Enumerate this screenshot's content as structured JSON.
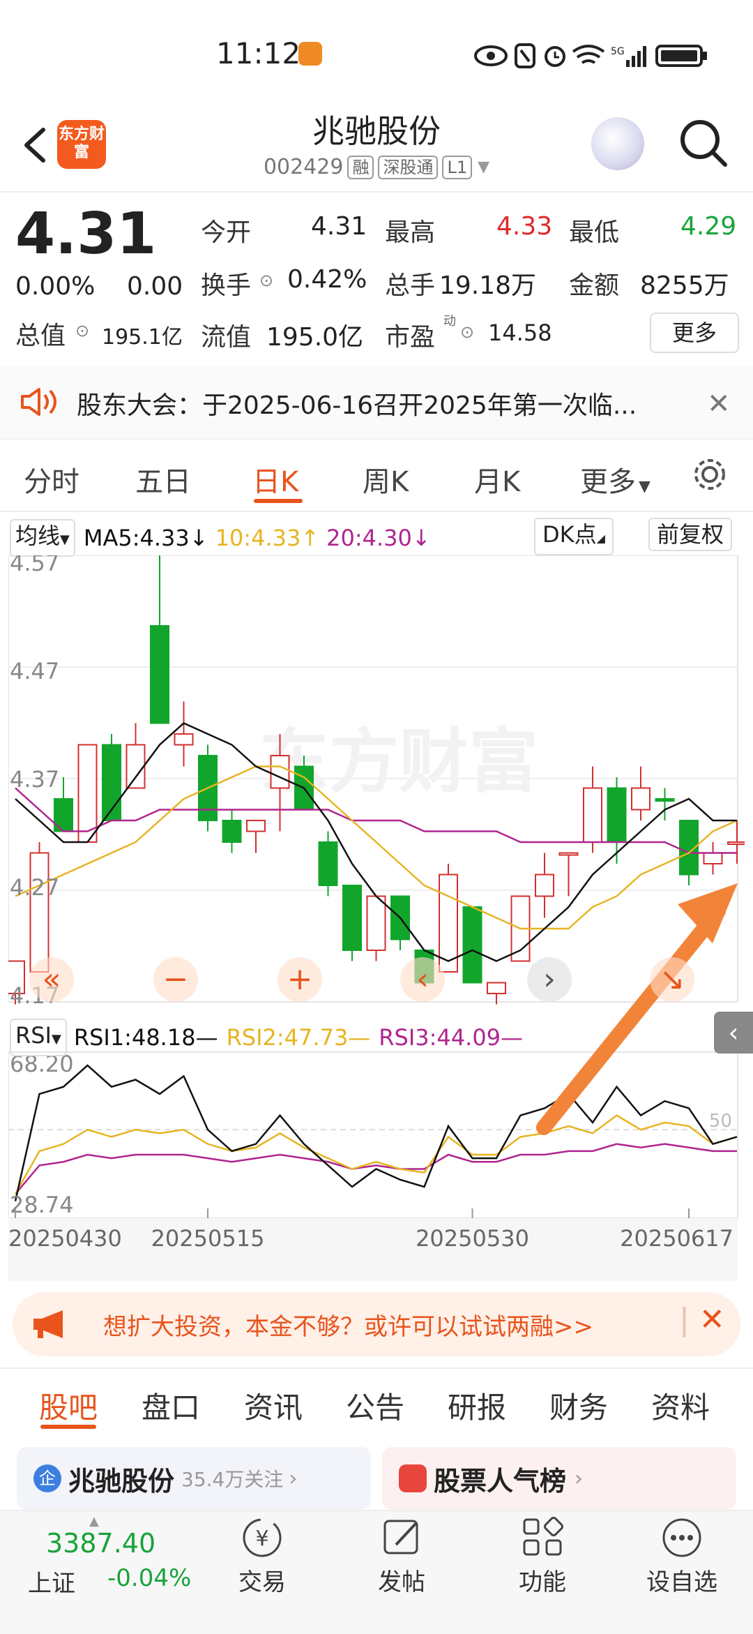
{
  "status_bar": {
    "time": "11:12",
    "network": "5G",
    "icons": [
      "eye-icon",
      "nfc-icon",
      "alarm-icon",
      "wifi-icon",
      "signal-icon",
      "battery-icon"
    ]
  },
  "header": {
    "logo_text": "东方财富",
    "name": "兆驰股份",
    "code": "002429",
    "tags": [
      "融",
      "深股通",
      "L1"
    ]
  },
  "quote": {
    "price": "4.31",
    "change_pct": "0.00%",
    "change": "0.00",
    "fields": {
      "open_label": "今开",
      "open": "4.31",
      "high_label": "最高",
      "high": "4.33",
      "low_label": "最低",
      "low": "4.29",
      "turnover_label": "换手",
      "turnover": "0.42%",
      "volume_label": "总手",
      "volume": "19.18万",
      "amount_label": "金额",
      "amount": "8255万",
      "mktcap_label": "总值",
      "mktcap": "195.1亿",
      "float_label": "流值",
      "float": "195.0亿",
      "pe_label": "市盈",
      "pe_sup": "动",
      "pe": "14.58"
    },
    "more_label": "更多"
  },
  "notice": {
    "text": "股东大会：于2025-06-16召开2025年第一次临..."
  },
  "period_tabs": [
    "分时",
    "五日",
    "日K",
    "周K",
    "月K",
    "更多"
  ],
  "active_period": "日K",
  "ma_bar": {
    "selector": "均线",
    "ma5": "MA5:4.33",
    "ma10": "10:4.33",
    "ma20": "20:4.30",
    "dk": "DK点",
    "adjust": "前复权"
  },
  "rsi_bar": {
    "selector": "RSI",
    "rsi1": "RSI1:48.18",
    "rsi2": "RSI2:47.73",
    "rsi3": "RSI3:44.09"
  },
  "chart_data": {
    "type": "candlestick",
    "watermark": "东方财富",
    "price_axis": {
      "ticks": [
        "4.57",
        "4.47",
        "4.37",
        "4.27",
        "4.17"
      ],
      "range": [
        4.17,
        4.57
      ]
    },
    "candles": [
      {
        "o": 4.17,
        "h": 4.2,
        "l": 4.16,
        "c": 4.2,
        "t": "red"
      },
      {
        "o": 4.19,
        "h": 4.31,
        "l": 4.19,
        "c": 4.3,
        "t": "red"
      },
      {
        "o": 4.35,
        "h": 4.37,
        "l": 4.33,
        "c": 4.32,
        "t": "green"
      },
      {
        "o": 4.31,
        "h": 4.4,
        "l": 4.31,
        "c": 4.4,
        "t": "red"
      },
      {
        "o": 4.4,
        "h": 4.41,
        "l": 4.33,
        "c": 4.33,
        "t": "green"
      },
      {
        "o": 4.36,
        "h": 4.42,
        "l": 4.36,
        "c": 4.4,
        "t": "red"
      },
      {
        "o": 4.51,
        "h": 4.58,
        "l": 4.42,
        "c": 4.42,
        "t": "green"
      },
      {
        "o": 4.4,
        "h": 4.44,
        "l": 4.38,
        "c": 4.41,
        "t": "red"
      },
      {
        "o": 4.39,
        "h": 4.4,
        "l": 4.32,
        "c": 4.33,
        "t": "green"
      },
      {
        "o": 4.33,
        "h": 4.34,
        "l": 4.3,
        "c": 4.31,
        "t": "green"
      },
      {
        "o": 4.32,
        "h": 4.33,
        "l": 4.3,
        "c": 4.33,
        "t": "red"
      },
      {
        "o": 4.36,
        "h": 4.41,
        "l": 4.32,
        "c": 4.39,
        "t": "red"
      },
      {
        "o": 4.38,
        "h": 4.39,
        "l": 4.34,
        "c": 4.34,
        "t": "green"
      },
      {
        "o": 4.31,
        "h": 4.32,
        "l": 4.26,
        "c": 4.27,
        "t": "green"
      },
      {
        "o": 4.27,
        "h": 4.27,
        "l": 4.2,
        "c": 4.21,
        "t": "green"
      },
      {
        "o": 4.21,
        "h": 4.26,
        "l": 4.2,
        "c": 4.26,
        "t": "red"
      },
      {
        "o": 4.26,
        "h": 4.26,
        "l": 4.21,
        "c": 4.22,
        "t": "green"
      },
      {
        "o": 4.21,
        "h": 4.21,
        "l": 4.18,
        "c": 4.18,
        "t": "green"
      },
      {
        "o": 4.19,
        "h": 4.29,
        "l": 4.19,
        "c": 4.28,
        "t": "red"
      },
      {
        "o": 4.25,
        "h": 4.25,
        "l": 4.18,
        "c": 4.18,
        "t": "green"
      },
      {
        "o": 4.17,
        "h": 4.18,
        "l": 4.16,
        "c": 4.18,
        "t": "red"
      },
      {
        "o": 4.2,
        "h": 4.26,
        "l": 4.2,
        "c": 4.26,
        "t": "red"
      },
      {
        "o": 4.26,
        "h": 4.3,
        "l": 4.24,
        "c": 4.28,
        "t": "red"
      },
      {
        "o": 4.3,
        "h": 4.3,
        "l": 4.26,
        "c": 4.3,
        "t": "red"
      },
      {
        "o": 4.31,
        "h": 4.38,
        "l": 4.3,
        "c": 4.36,
        "t": "red"
      },
      {
        "o": 4.36,
        "h": 4.37,
        "l": 4.29,
        "c": 4.31,
        "t": "green"
      },
      {
        "o": 4.34,
        "h": 4.38,
        "l": 4.33,
        "c": 4.36,
        "t": "red"
      },
      {
        "o": 4.35,
        "h": 4.36,
        "l": 4.33,
        "c": 4.35,
        "t": "green"
      },
      {
        "o": 4.33,
        "h": 4.33,
        "l": 4.27,
        "c": 4.28,
        "t": "green"
      },
      {
        "o": 4.29,
        "h": 4.31,
        "l": 4.28,
        "c": 4.3,
        "t": "red"
      },
      {
        "o": 4.31,
        "h": 4.33,
        "l": 4.29,
        "c": 4.31,
        "t": "red"
      }
    ],
    "ma5": [
      4.35,
      4.33,
      4.31,
      4.31,
      4.34,
      4.37,
      4.4,
      4.42,
      4.41,
      4.4,
      4.38,
      4.37,
      4.36,
      4.33,
      4.29,
      4.26,
      4.24,
      4.21,
      4.2,
      4.21,
      4.2,
      4.21,
      4.23,
      4.25,
      4.28,
      4.3,
      4.32,
      4.34,
      4.35,
      4.33,
      4.33
    ],
    "ma10": [
      4.26,
      4.27,
      4.28,
      4.29,
      4.3,
      4.31,
      4.33,
      4.35,
      4.36,
      4.37,
      4.38,
      4.38,
      4.37,
      4.35,
      4.33,
      4.31,
      4.29,
      4.27,
      4.26,
      4.25,
      4.24,
      4.23,
      4.23,
      4.23,
      4.25,
      4.26,
      4.28,
      4.29,
      4.3,
      4.32,
      4.33
    ],
    "ma20": [
      4.36,
      4.34,
      4.32,
      4.32,
      4.33,
      4.33,
      4.34,
      4.34,
      4.34,
      4.34,
      4.34,
      4.34,
      4.34,
      4.34,
      4.33,
      4.33,
      4.33,
      4.32,
      4.32,
      4.32,
      4.32,
      4.31,
      4.31,
      4.31,
      4.31,
      4.31,
      4.31,
      4.31,
      4.3,
      4.3,
      4.3
    ],
    "rsi_axis": {
      "ticks": [
        "68.20",
        "28.74"
      ],
      "range": [
        28.74,
        68.2
      ],
      "midline": "50"
    },
    "rsi1": [
      30,
      60,
      62,
      68,
      62,
      64,
      60,
      65,
      50,
      44,
      46,
      54,
      46,
      40,
      34,
      39,
      36,
      34,
      51,
      42,
      42,
      54,
      56,
      60,
      52,
      62,
      54,
      58,
      56,
      46,
      48
    ],
    "rsi2": [
      32,
      44,
      46,
      50,
      48,
      50,
      49,
      50,
      46,
      44,
      45,
      49,
      45,
      42,
      39,
      41,
      39,
      38,
      48,
      43,
      43,
      48,
      49,
      51,
      49,
      54,
      50,
      52,
      51,
      46,
      48
    ],
    "rsi3": [
      32,
      40,
      41,
      43,
      42,
      43,
      43,
      43,
      42,
      41,
      42,
      43,
      42,
      41,
      39,
      40,
      39,
      39,
      43,
      41,
      41,
      43,
      43,
      44,
      44,
      46,
      45,
      46,
      45,
      44,
      44
    ],
    "dates": [
      "20250430",
      "20250515",
      "20250530",
      "20250617"
    ]
  },
  "chart_controls": [
    "«",
    "−",
    "+",
    "‹",
    "›",
    "↘"
  ],
  "promo": {
    "text": "想扩大投资，本金不够？或许可以试试两融>>"
  },
  "bottom_tabs": [
    "股吧",
    "盘口",
    "资讯",
    "公告",
    "研报",
    "财务",
    "资料"
  ],
  "active_bottom_tab": "股吧",
  "cards": [
    {
      "icon": "企",
      "title": "兆驰股份",
      "sub": "35.4万关注"
    },
    {
      "icon": "",
      "title": "股票人气榜",
      "sub": ""
    }
  ],
  "nav": {
    "index_value": "3387.40",
    "index_name": "上证",
    "index_change": "-0.04%",
    "items": [
      "交易",
      "发帖",
      "功能",
      "设自选"
    ]
  },
  "colors": {
    "up": "#d32f2f",
    "down": "#12a52b",
    "accent": "#e8541c",
    "ma5": "#111111",
    "ma10": "#e6b422",
    "ma20": "#b0248f",
    "arrow": "#f2843a"
  }
}
